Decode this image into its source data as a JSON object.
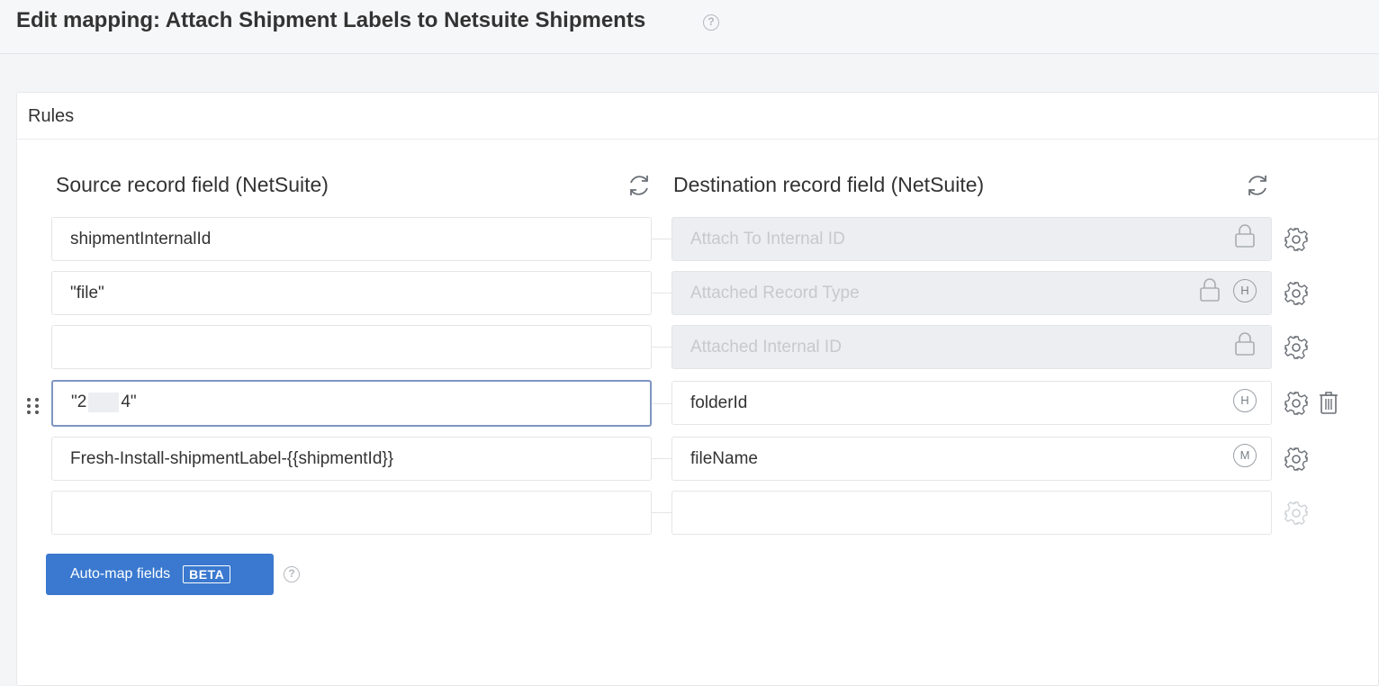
{
  "page": {
    "title": "Edit mapping: Attach Shipment Labels to Netsuite Shipments",
    "help_icon": "?"
  },
  "panel": {
    "title": "Rules"
  },
  "columns": {
    "source_heading": "Source record field (NetSuite)",
    "destination_heading": "Destination record field (NetSuite)"
  },
  "rows": [
    {
      "source": "shipmentInternalId",
      "destination": "Attach To Internal ID",
      "destination_locked": true,
      "badge": ""
    },
    {
      "source": "\"file\"",
      "destination": "Attached Record Type",
      "destination_locked": true,
      "badge": "H"
    },
    {
      "source": "",
      "destination": "Attached Internal ID",
      "destination_locked": true,
      "badge": ""
    },
    {
      "source_prefix": "\"2",
      "source_suffix": "4\"",
      "destination": "folderId",
      "destination_locked": false,
      "badge": "H"
    },
    {
      "source": "Fresh-Install-shipmentLabel-{{shipmentId}}",
      "destination": "fileName",
      "destination_locked": false,
      "badge": "M"
    },
    {
      "source": "",
      "destination": "",
      "destination_locked": false,
      "badge": ""
    }
  ],
  "auto_map": {
    "label": "Auto-map fields",
    "badge": "BETA"
  },
  "icons": {
    "refresh": "refresh-icon",
    "lock": "lock-icon",
    "gear": "gear-icon",
    "trash": "trash-icon",
    "drag": "drag-handle-icon",
    "help": "help-icon"
  },
  "colors": {
    "primary_button": "#3a79cf",
    "active_border": "#7f95c2",
    "locked_field_bg": "#eceef1"
  }
}
